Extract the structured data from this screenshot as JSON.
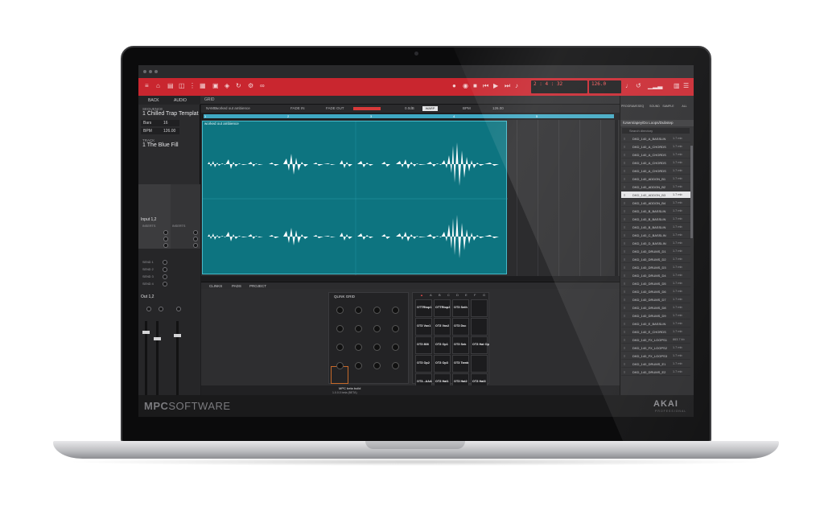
{
  "toolbar": {
    "grid_label": "GRID",
    "lcd_bars": "2",
    "lcd_beats": "4",
    "lcd_ticks": "32",
    "tempo": "126.0",
    "accent": "#c9262f"
  },
  "left_panel": {
    "tab_back": "BACK",
    "tab_audio": "AUDIO",
    "sequence_small": "SEQUENCE",
    "sequence_name": "1 Chilled Trap Templat",
    "bars_label": "Bars",
    "bars_value": "16",
    "bpm_label": "BPM",
    "bpm_value": "126.00",
    "track_small": "TRACK",
    "track_name": "1 The Blue Fill",
    "input_label": "Input 1,2",
    "inserts_label": "INSERTS",
    "inserts_label2": "INSERTS",
    "sends": [
      "SEND 1",
      "SEND 2",
      "SEND 3",
      "SEND 4"
    ],
    "out_label": "Out 1,2",
    "out_a": "The Blue Fill",
    "out_b": "Outputs 1/2"
  },
  "editor": {
    "clip_name": "worked out ambience",
    "fade_in": "FADE IN",
    "fade_out": "FADE OUT",
    "level": "LEVEL",
    "db_value": "0.0dB",
    "warp": "WARP",
    "bpm_label": "BPM",
    "bpm_value": "126.00",
    "ruler": [
      "1",
      "2",
      "3",
      "4",
      "5"
    ]
  },
  "bottom": {
    "tabs": [
      "CLINKS",
      "PADS",
      "PROJECT"
    ],
    "qgrid_title": "QLINK GRID",
    "columns": [
      "A",
      "B",
      "C",
      "D",
      "E",
      "F",
      "G",
      "H"
    ],
    "pads": [
      [
        "OTTRtop1",
        "OTTRtop2",
        "OT3 Snth"
      ],
      [
        "OT3 Vox1",
        "OT3 Vox2",
        "OT3 Dsc"
      ],
      [
        "OT3 808",
        "OT3 Op1",
        "OT3 Snk",
        "OT3 Hat Op"
      ],
      [
        "OT3 Op2",
        "OT3 Op3",
        "OT3 Tamb"
      ],
      [
        "OT3...AAA",
        "OT3 Hat1",
        "OT3 Hat2",
        "OT3 Hat3"
      ]
    ],
    "status_a": "MPC beta build",
    "status_b": "1.0.0.0 beta (BETA)"
  },
  "browser": {
    "tabs": [
      "PROGRAMS",
      "SEQ",
      "SOUND",
      "SAMPLE",
      "ALL"
    ],
    "path": "/Users/apey/Do Loops/Dubstep",
    "search_placeholder": "Search directory",
    "rows": [
      {
        "name": "DKD_140_A_BASSLIN",
        "size": "1.7 mb"
      },
      {
        "name": "DKD_140_A_CHORDS",
        "size": "1.7 mb"
      },
      {
        "name": "DKD_140_A_CHORDS",
        "size": "1.7 mb"
      },
      {
        "name": "DKD_140_A_CHORDS",
        "size": "1.7 mb"
      },
      {
        "name": "DKD_140_A_CHORDS",
        "size": "1.7 mb"
      },
      {
        "name": "DKD_140_ADDON_B1",
        "size": "1.7 mb"
      },
      {
        "name": "DKD_140_ADDON_B2",
        "size": "1.7 mb"
      },
      {
        "name": "DKD_140_ADDON_B3",
        "size": "1.7 mb",
        "selected": true
      },
      {
        "name": "DKD_140_ADDON_B4",
        "size": "1.7 mb"
      },
      {
        "name": "DKD_140_B_BASSLIN",
        "size": "1.7 mb"
      },
      {
        "name": "DKD_140_B_BASSLIN",
        "size": "1.7 mb"
      },
      {
        "name": "DKD_140_B_BASSLIN",
        "size": "1.7 mb"
      },
      {
        "name": "DKD_140_C_BASSLIN",
        "size": "1.7 mb"
      },
      {
        "name": "DKD_140_D_BASSLIN",
        "size": "1.7 mb"
      },
      {
        "name": "DKD_140_DRUMS_D1",
        "size": "1.7 mb"
      },
      {
        "name": "DKD_140_DRUMS_D2",
        "size": "1.7 mb"
      },
      {
        "name": "DKD_140_DRUMS_D3",
        "size": "1.7 mb"
      },
      {
        "name": "DKD_140_DRUMS_D4",
        "size": "1.7 mb"
      },
      {
        "name": "DKD_140_DRUMS_D5",
        "size": "1.7 mb"
      },
      {
        "name": "DKD_140_DRUMS_D6",
        "size": "1.7 mb"
      },
      {
        "name": "DKD_140_DRUMS_D7",
        "size": "1.7 mb"
      },
      {
        "name": "DKD_140_DRUMS_D8",
        "size": "1.7 mb"
      },
      {
        "name": "DKD_140_DRUMS_D9",
        "size": "1.7 mb"
      },
      {
        "name": "DKD_140_E_BASSLIN",
        "size": "1.7 mb"
      },
      {
        "name": "DKD_140_E_CHORDS",
        "size": "1.7 mb"
      },
      {
        "name": "DKD_140_FX_LOOPS1",
        "size": "863.7 kb"
      },
      {
        "name": "DKD_140_FX_LOOPS2",
        "size": "1.7 mb"
      },
      {
        "name": "DKD_140_FX_LOOPS3",
        "size": "1.7 mb"
      },
      {
        "name": "DKD_140_DRUMS_E1",
        "size": "1.7 mb"
      },
      {
        "name": "DKD_140_DRUMS_E2",
        "size": "1.7 mb"
      }
    ]
  },
  "footer": {
    "mpc": "MPC",
    "software": "SOFTWARE",
    "akai": "AKAI",
    "akai_sub": "PROFESSIONAL"
  }
}
